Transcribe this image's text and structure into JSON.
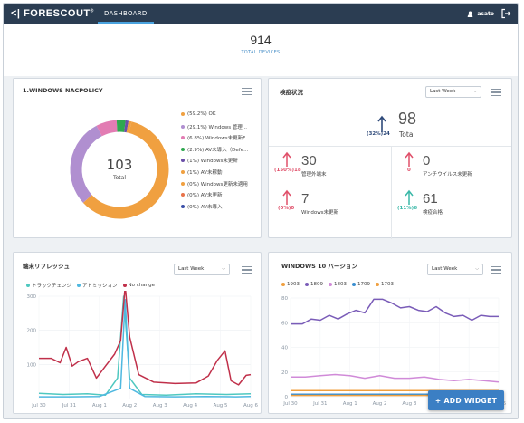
{
  "header": {
    "logo": "FORESCOUT",
    "tab_dashboard": "DASHBOARD",
    "user_name": "asato"
  },
  "summary": {
    "total": "914",
    "total_label": "TOTAL DEVICES"
  },
  "nacpolicy": {
    "title": "1.WINDOWS NACPOLICY",
    "center_value": "103",
    "center_label": "Total",
    "legend": [
      {
        "label": "(59.2%) OK",
        "color": "#f0a040",
        "pct": 59.2
      },
      {
        "label": "(29.1%) Windows 管理...",
        "color": "#b08fd0",
        "pct": 29.1
      },
      {
        "label": "(6.8%) Windows未更新F...",
        "color": "#e27cb3",
        "pct": 6.8
      },
      {
        "label": "(2.9%) AV未導入（Defe...",
        "color": "#2fa84f",
        "pct": 2.9
      },
      {
        "label": "(1%) Windows未更新",
        "color": "#6b4fa8",
        "pct": 1
      },
      {
        "label": "(1%) AV未稼動",
        "color": "#f0a040",
        "pct": 1
      },
      {
        "label": "(0%) Windows更新未適用",
        "color": "#f0a040",
        "pct": 0
      },
      {
        "label": "(0%) AV未更新",
        "color": "#e8734a",
        "pct": 0
      },
      {
        "label": "(0%) AV未導入",
        "color": "#3a4fa8",
        "pct": 0
      }
    ]
  },
  "inspection": {
    "title": "検疫状況",
    "select_value": "Last Week",
    "total_value": "98",
    "total_label": "Total",
    "total_change": "(32%)24",
    "metrics": [
      {
        "value": "30",
        "label": "管理外端末",
        "change": "(150%)18",
        "color": "#e0506a"
      },
      {
        "value": "0",
        "label": "アンチウイルス未更新",
        "change": "0",
        "color": "#e0506a"
      },
      {
        "value": "7",
        "label": "Windows未更新",
        "change": "(0%)0",
        "color": "#e0506a"
      },
      {
        "value": "61",
        "label": "検疫合格",
        "change": "(11%)6",
        "color": "#3bb8a8"
      }
    ]
  },
  "refresh_chart": {
    "title": "端末リフレッシュ",
    "select_value": "Last Week",
    "legend": [
      {
        "label": "トラックチェンジ",
        "color": "#4fc8c0"
      },
      {
        "label": "アドミッション",
        "color": "#4fb8e0"
      },
      {
        "label": "No change",
        "color": "#c0304a"
      }
    ]
  },
  "version_chart": {
    "title": "WINDOWS 10 バージョン",
    "select_value": "Last Week",
    "legend": [
      {
        "label": "1903",
        "color": "#f0a040"
      },
      {
        "label": "1809",
        "color": "#7a5cb8"
      },
      {
        "label": "1803",
        "color": "#d08ad8"
      },
      {
        "label": "1709",
        "color": "#3a8fd0"
      },
      {
        "label": "1703",
        "color": "#f0a040"
      }
    ]
  },
  "add_widget_label": "+ ADD WIDGET",
  "chart_data": [
    {
      "type": "line",
      "title": "端末リフレッシュ",
      "x": [
        "Jul 30",
        "Jul 31",
        "Aug 1",
        "Aug 2",
        "Aug 3",
        "Aug 4",
        "Aug 5",
        "Aug 6"
      ],
      "ylim": [
        0,
        300
      ],
      "yticks": [
        100,
        200,
        300
      ],
      "series": [
        {
          "name": "トラックチェンジ",
          "color": "#4fc8c0",
          "points": [
            [
              0,
              15
            ],
            [
              0.8,
              12
            ],
            [
              1.6,
              14
            ],
            [
              2.2,
              10
            ],
            [
              2.6,
              60
            ],
            [
              2.8,
              300
            ],
            [
              3.0,
              60
            ],
            [
              3.4,
              12
            ],
            [
              4.2,
              10
            ],
            [
              5.2,
              14
            ],
            [
              6.2,
              12
            ],
            [
              7,
              14
            ]
          ]
        },
        {
          "name": "アドミッション",
          "color": "#4fb8e0",
          "points": [
            [
              0,
              5
            ],
            [
              1,
              5
            ],
            [
              2,
              6
            ],
            [
              2.7,
              30
            ],
            [
              2.85,
              290
            ],
            [
              3.0,
              30
            ],
            [
              3.5,
              6
            ],
            [
              4.5,
              5
            ],
            [
              5.5,
              6
            ],
            [
              6.5,
              5
            ],
            [
              7,
              6
            ]
          ]
        },
        {
          "name": "No change",
          "color": "#c0304a",
          "points": [
            [
              0,
              118
            ],
            [
              0.4,
              118
            ],
            [
              0.7,
              105
            ],
            [
              0.9,
              150
            ],
            [
              1.1,
              95
            ],
            [
              1.3,
              108
            ],
            [
              1.6,
              118
            ],
            [
              1.9,
              60
            ],
            [
              2.2,
              95
            ],
            [
              2.5,
              130
            ],
            [
              2.7,
              170
            ],
            [
              2.85,
              330
            ],
            [
              3.0,
              180
            ],
            [
              3.3,
              70
            ],
            [
              3.8,
              48
            ],
            [
              4.5,
              44
            ],
            [
              5.2,
              46
            ],
            [
              5.6,
              66
            ],
            [
              5.9,
              112
            ],
            [
              6.15,
              140
            ],
            [
              6.35,
              52
            ],
            [
              6.6,
              40
            ],
            [
              6.85,
              68
            ],
            [
              7,
              70
            ]
          ]
        }
      ]
    },
    {
      "type": "line",
      "title": "WINDOWS 10 バージョン",
      "x": [
        "Jul 30",
        "Jul 31",
        "Aug 1",
        "Aug 2",
        "Aug 3",
        "Aug 4",
        "Aug 5",
        "Aug 6"
      ],
      "ylim": [
        0,
        80
      ],
      "yticks": [
        0,
        20,
        40,
        60,
        80
      ],
      "series": [
        {
          "name": "1903",
          "color": "#f0a040",
          "points": [
            [
              0,
              5
            ],
            [
              7,
              5
            ]
          ]
        },
        {
          "name": "1809",
          "color": "#7a5cb8",
          "points": [
            [
              0,
              59
            ],
            [
              0.4,
              59
            ],
            [
              0.7,
              63
            ],
            [
              1.0,
              62
            ],
            [
              1.3,
              66
            ],
            [
              1.6,
              63
            ],
            [
              1.9,
              67
            ],
            [
              2.2,
              70
            ],
            [
              2.5,
              68
            ],
            [
              2.8,
              79
            ],
            [
              3.1,
              79
            ],
            [
              3.4,
              76
            ],
            [
              3.7,
              72
            ],
            [
              4.0,
              73
            ],
            [
              4.3,
              70
            ],
            [
              4.6,
              69
            ],
            [
              4.9,
              73
            ],
            [
              5.2,
              68
            ],
            [
              5.5,
              65
            ],
            [
              5.8,
              66
            ],
            [
              6.1,
              62
            ],
            [
              6.4,
              66
            ],
            [
              6.7,
              65
            ],
            [
              7,
              65
            ]
          ]
        },
        {
          "name": "1803",
          "color": "#d08ad8",
          "points": [
            [
              0,
              16
            ],
            [
              0.5,
              16
            ],
            [
              1.0,
              17
            ],
            [
              1.5,
              18
            ],
            [
              2.0,
              17
            ],
            [
              2.5,
              15
            ],
            [
              3.0,
              17
            ],
            [
              3.5,
              15
            ],
            [
              4.0,
              15
            ],
            [
              4.5,
              16
            ],
            [
              5.0,
              14
            ],
            [
              5.5,
              13
            ],
            [
              6.0,
              14
            ],
            [
              6.5,
              13
            ],
            [
              7,
              12
            ]
          ]
        },
        {
          "name": "1709",
          "color": "#3a8fd0",
          "points": [
            [
              0,
              2
            ],
            [
              7,
              2
            ]
          ]
        },
        {
          "name": "1703",
          "color": "#f0a040",
          "points": [
            [
              0,
              1
            ],
            [
              7,
              1
            ]
          ]
        }
      ]
    }
  ]
}
